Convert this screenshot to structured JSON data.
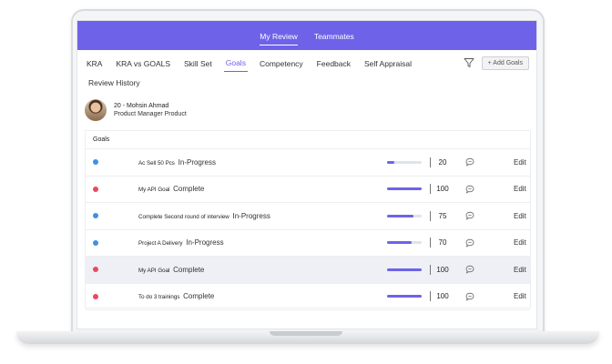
{
  "header": {
    "tabs": [
      {
        "label": "My Review",
        "active": true
      },
      {
        "label": "Teammates",
        "active": false
      }
    ]
  },
  "nav": {
    "items": [
      "KRA",
      "KRA vs GOALS",
      "Skill Set",
      "Goals",
      "Competency",
      "Feedback",
      "Self Appraisal"
    ],
    "active": "Goals",
    "second_row": "Review History",
    "add_goals_label": "+ Add Goals",
    "filter_icon": "filter-icon"
  },
  "user": {
    "name": "20 - Mohsin Ahmad",
    "role": "Product Manager Product"
  },
  "goals": {
    "header": "Goals",
    "edit_label": "Edit",
    "rows": [
      {
        "title": "Ac Sell 50 Pcs",
        "status": "In-Progress",
        "score": "20",
        "progress": 0.2,
        "dot_color": "#3f8fe4",
        "highlighted": false
      },
      {
        "title": "My API Goal",
        "status": "Complete",
        "score": "100",
        "progress": 1.0,
        "dot_color": "#e84a5f",
        "highlighted": false
      },
      {
        "title": "Complete Second round of interview",
        "status": "In-Progress",
        "score": "75",
        "progress": 0.75,
        "dot_color": "#3f8fe4",
        "highlighted": false
      },
      {
        "title": "Project A Delivery",
        "status": "In-Progress",
        "score": "70",
        "progress": 0.7,
        "dot_color": "#3f8fe4",
        "highlighted": false
      },
      {
        "title": "My API Goal",
        "status": "Complete",
        "score": "100",
        "progress": 1.0,
        "dot_color": "#e84a5f",
        "highlighted": true
      },
      {
        "title": "To do 3 trainings",
        "status": "Complete",
        "score": "100",
        "progress": 1.0,
        "dot_color": "#e84a5f",
        "highlighted": false
      }
    ]
  },
  "colors": {
    "accent": "#6e63e8",
    "in_progress": "#3f8fe4",
    "complete": "#e84a5f"
  }
}
